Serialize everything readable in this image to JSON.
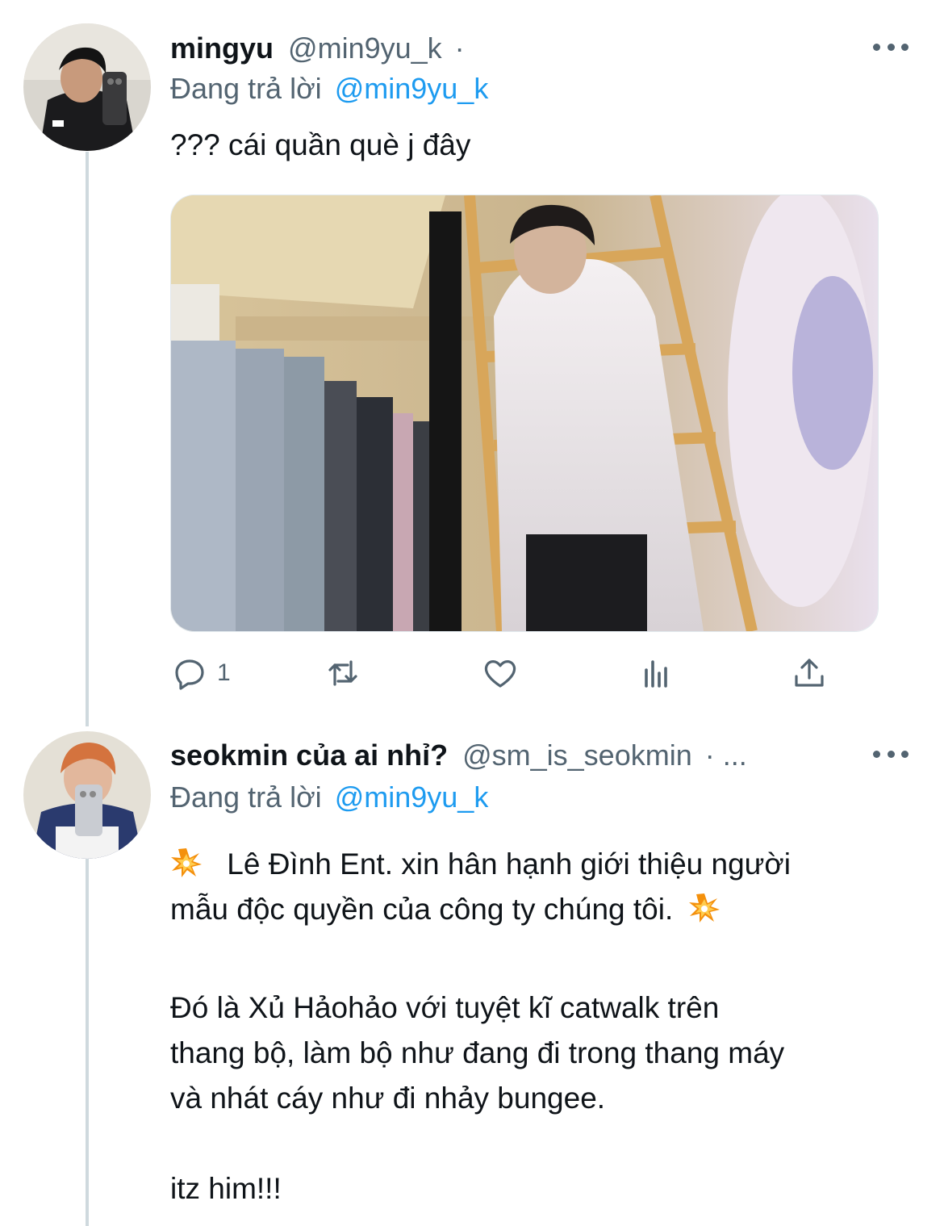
{
  "tweets": [
    {
      "author_name": "mingyu",
      "author_handle": "@min9yu_k",
      "separator": "·",
      "replying_to_label": "Đang trả lời",
      "replying_to_handle": "@min9yu_k",
      "text": "??? cái quần què j đây",
      "media_alt": "",
      "actions": {
        "reply_count": "1",
        "retweet_count": "",
        "like_count": ""
      }
    },
    {
      "author_name": "seokmin của ai nhỉ?",
      "author_handle": "@sm_is_seokmin",
      "separator": "· ...",
      "replying_to_label": "Đang trả lời",
      "replying_to_handle": "@min9yu_k",
      "paragraphs": [
        "Lê Đình Ent. xin hân hạnh giới thiệu người",
        "mẫu độc quyền của công ty chúng tôi.",
        "Đó là Xủ Hảohảo với tuyệt kĩ catwalk trên",
        "thang bộ, làm bộ như đang đi trong thang máy",
        "và nhát cáy như đi nhảy bungee.",
        "itz him!!!"
      ],
      "emoji": "collision-emoji"
    }
  ],
  "icons": {
    "reply": "reply-icon",
    "retweet": "retweet-icon",
    "like": "heart-icon",
    "analytics": "analytics-icon",
    "share": "share-icon",
    "more": "more-icon"
  },
  "colors": {
    "text": "#0f1419",
    "secondary": "#536471",
    "link": "#1d9bf0",
    "thread_line": "#cfd9de"
  }
}
